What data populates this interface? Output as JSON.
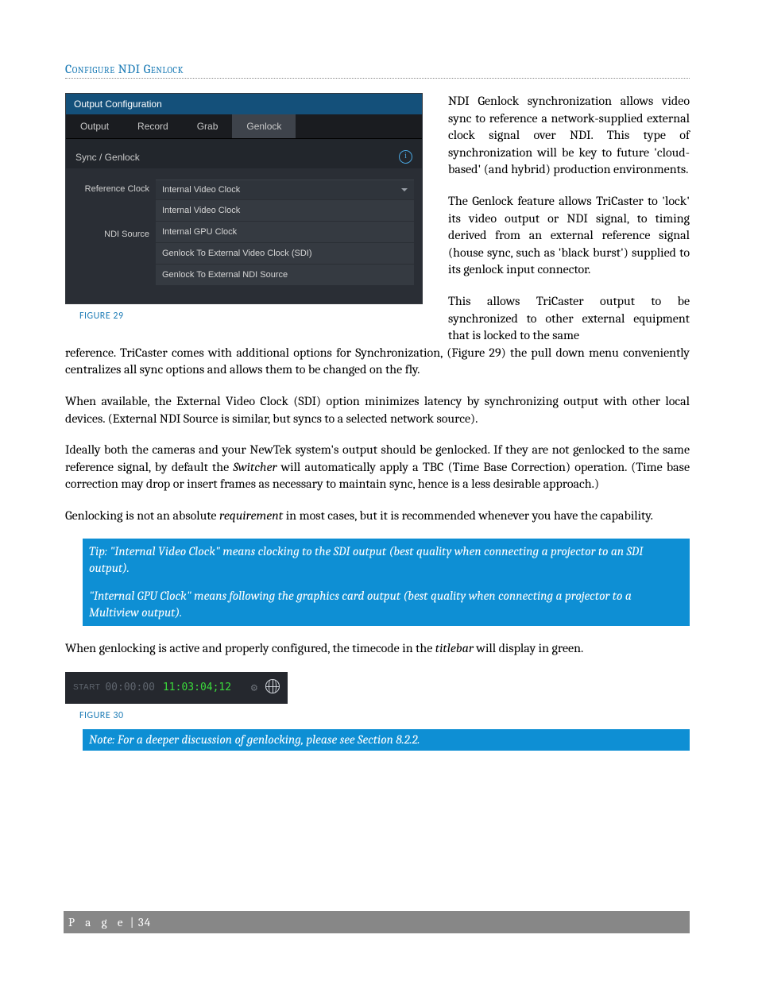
{
  "heading": "Configure NDI Genlock",
  "panel": {
    "title": "Output Configuration",
    "tabs": [
      "Output",
      "Record",
      "Grab",
      "Genlock"
    ],
    "activeTabIndex": 3,
    "sectionLabel": "Sync / Genlock",
    "rows": {
      "refClockLabel": "Reference Clock",
      "ndiSourceLabel": "NDI Source",
      "selected": "Internal Video Clock",
      "options": [
        "Internal Video Clock",
        "Internal GPU Clock",
        "Genlock To External Video Clock (SDI)",
        "Genlock To External NDI Source"
      ]
    }
  },
  "fig29": "FIGURE 29",
  "right": {
    "p1": "NDI Genlock synchronization allows video sync to reference a network-supplied external clock signal over NDI. This type of synchronization will be key to future 'cloud-based' (and hybrid) production environments.",
    "p2": "The Genlock feature allows TriCaster to 'lock' its video output or NDI signal, to timing derived from an external reference signal (house sync, such as 'black burst') supplied to its genlock input connector.",
    "p3lead": "This allows TriCaster output to be synchronized to other external equipment that is locked to the same"
  },
  "body": {
    "p3rest": "reference.  TriCaster comes with additional options for Synchronization, (Figure 29) the pull down menu conveniently centralizes all sync options and allows them to be changed on the fly.",
    "p4": "When available, the External Video Clock (SDI) option minimizes latency by synchronizing output with other local devices.  (External NDI Source is similar, but syncs to a selected network source).",
    "p5a": "Ideally both the cameras and your NewTek system's output should be genlocked.  If they are not genlocked to the same reference signal, by default the ",
    "p5i": "Switcher",
    "p5b": " will automatically apply a TBC (Time Base Correction) operation.  (Time base correction may drop or insert frames as necessary to maintain sync, hence is a less desirable approach.)",
    "p6a": "Genlocking is not an absolute ",
    "p6i": "requirement",
    "p6b": " in most cases, but it is recommended whenever you have the capability."
  },
  "tip": {
    "p1": "Tip:  \"Internal Video Clock\" means clocking to the SDI output (best quality when connecting a projector to an SDI output).",
    "p2": "\"Internal GPU Clock\" means following the graphics card output (best quality when connecting a projector to a Multiview output)."
  },
  "afterTip": {
    "a": "When genlocking is active and properly configured, the timecode in the ",
    "i": "titlebar",
    "b": " will display in green."
  },
  "timecode": {
    "startLabel": "START",
    "zero": "00:00:00",
    "green": "11:03:04;12"
  },
  "fig30": "FIGURE 30",
  "note": "Note: For a deeper discussion of genlocking, please see Section 8.2.2.",
  "footer": {
    "word": "P a g e",
    "sep": " | ",
    "num": "34"
  }
}
